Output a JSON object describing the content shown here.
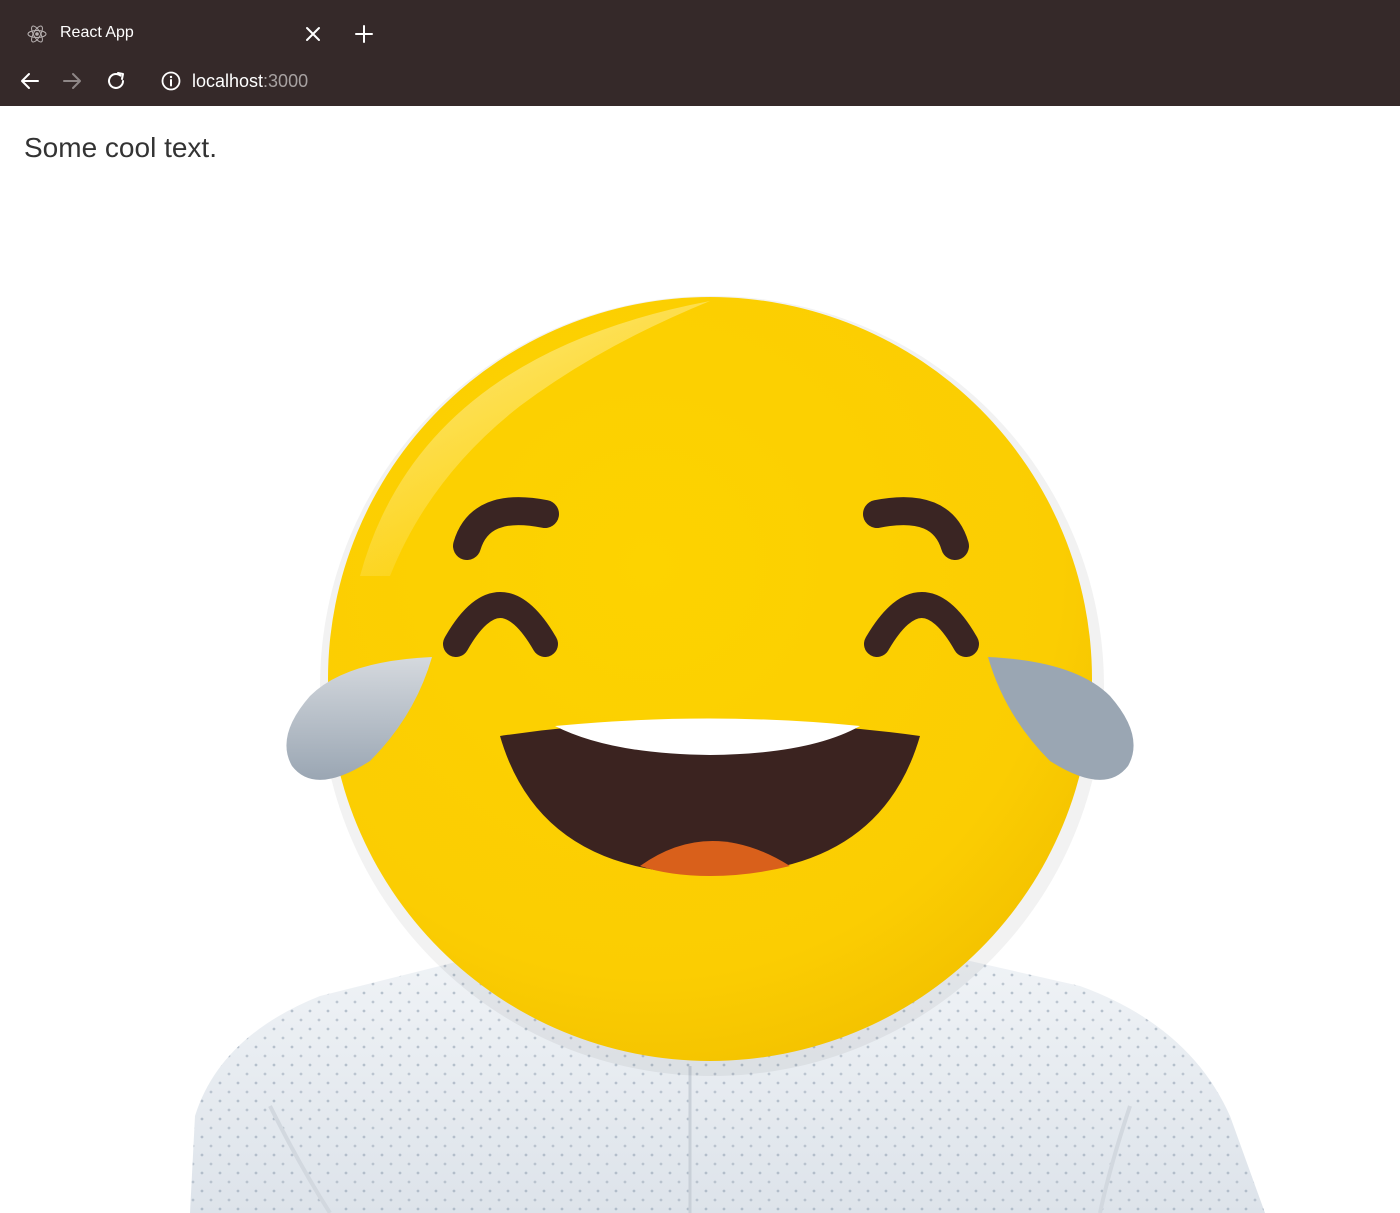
{
  "browser": {
    "tab_title": "React App",
    "url_host": "localhost",
    "url_port": ":3000",
    "icons": {
      "favicon": "react-logo-icon",
      "close": "close-icon",
      "new_tab": "plus-icon",
      "back": "arrow-left-icon",
      "forward": "arrow-right-icon",
      "reload": "reload-icon",
      "site_info": "info-icon"
    }
  },
  "page": {
    "text": "Some cool text.",
    "image": "laughing-crying-emoji-face-person-in-shirt"
  },
  "colors": {
    "chrome_bg": "#352929",
    "emoji_yellow": "#FBCD03",
    "emoji_dark": "#3B2320",
    "tear_blue": "#9AA8B6",
    "tongue_orange": "#D9601B"
  }
}
